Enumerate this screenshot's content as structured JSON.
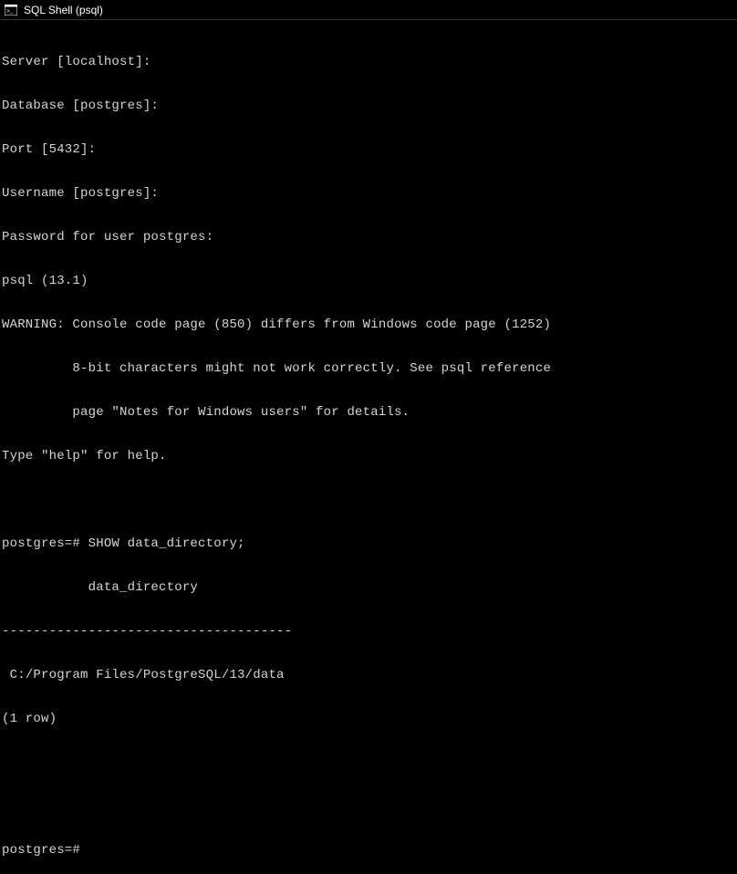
{
  "window": {
    "title": "SQL Shell (psql)"
  },
  "terminal": {
    "lines": [
      "Server [localhost]:",
      "Database [postgres]:",
      "Port [5432]:",
      "Username [postgres]:",
      "Password for user postgres:",
      "psql (13.1)",
      "WARNING: Console code page (850) differs from Windows code page (1252)",
      "         8-bit characters might not work correctly. See psql reference",
      "         page \"Notes for Windows users\" for details.",
      "Type \"help\" for help.",
      "",
      "postgres=# SHOW data_directory;",
      "           data_directory",
      "-------------------------------------",
      " C:/Program Files/PostgreSQL/13/data",
      "(1 row)",
      "",
      "",
      "postgres=#"
    ]
  }
}
